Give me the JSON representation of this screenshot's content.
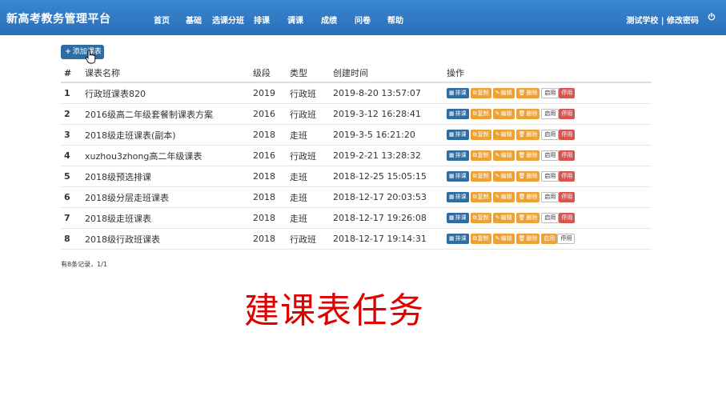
{
  "navbar": {
    "brand": "新高考教务管理平台",
    "items": [
      "首页",
      "基础",
      "选课分班",
      "排课",
      "调课",
      "成绩",
      "问卷",
      "帮助"
    ],
    "user": "测试学校 | 修改密码",
    "power_icon": "power-icon"
  },
  "toolbar": {
    "add_label": "添加课表"
  },
  "table": {
    "headers": [
      "#",
      "课表名称",
      "级段",
      "类型",
      "创建时间",
      "操作"
    ],
    "rows": [
      {
        "idx": "1",
        "name": "行政班课表820",
        "level": "2019",
        "type": "行政班",
        "time": "2019-8-20 13:57:07",
        "active": "stop"
      },
      {
        "idx": "2",
        "name": "2016级高二年级套餐制课表方案",
        "level": "2016",
        "type": "行政班",
        "time": "2019-3-12 16:28:41",
        "active": "stop"
      },
      {
        "idx": "3",
        "name": "2018级走班课表(副本)",
        "level": "2018",
        "type": "走班",
        "time": "2019-3-5 16:21:20",
        "active": "stop"
      },
      {
        "idx": "4",
        "name": "xuzhou3zhong高二年级课表",
        "level": "2016",
        "type": "行政班",
        "time": "2019-2-21 13:28:32",
        "active": "stop"
      },
      {
        "idx": "5",
        "name": "2018级预选排课",
        "level": "2018",
        "type": "走班",
        "time": "2018-12-25 15:05:15",
        "active": "stop"
      },
      {
        "idx": "6",
        "name": "2018级分层走班课表",
        "level": "2018",
        "type": "走班",
        "time": "2018-12-17 20:03:53",
        "active": "stop"
      },
      {
        "idx": "7",
        "name": "2018级走班课表",
        "level": "2018",
        "type": "走班",
        "time": "2018-12-17 19:26:08",
        "active": "stop"
      },
      {
        "idx": "8",
        "name": "2018级行政班课表",
        "level": "2018",
        "type": "行政班",
        "time": "2018-12-17 19:14:31",
        "active": "start"
      }
    ],
    "actions": {
      "schedule": "排课",
      "copy": "复制",
      "edit": "编辑",
      "delete": "删除",
      "enable": "启用",
      "disable": "停用"
    }
  },
  "footer": {
    "count": "有8条记录，1/1"
  },
  "overlay": {
    "caption": "建课表任务"
  },
  "colors": {
    "navbar": "#2f7bc6",
    "primary": "#2e6da4",
    "warning": "#eea236",
    "danger": "#d9534f",
    "caption": "#e00000"
  }
}
